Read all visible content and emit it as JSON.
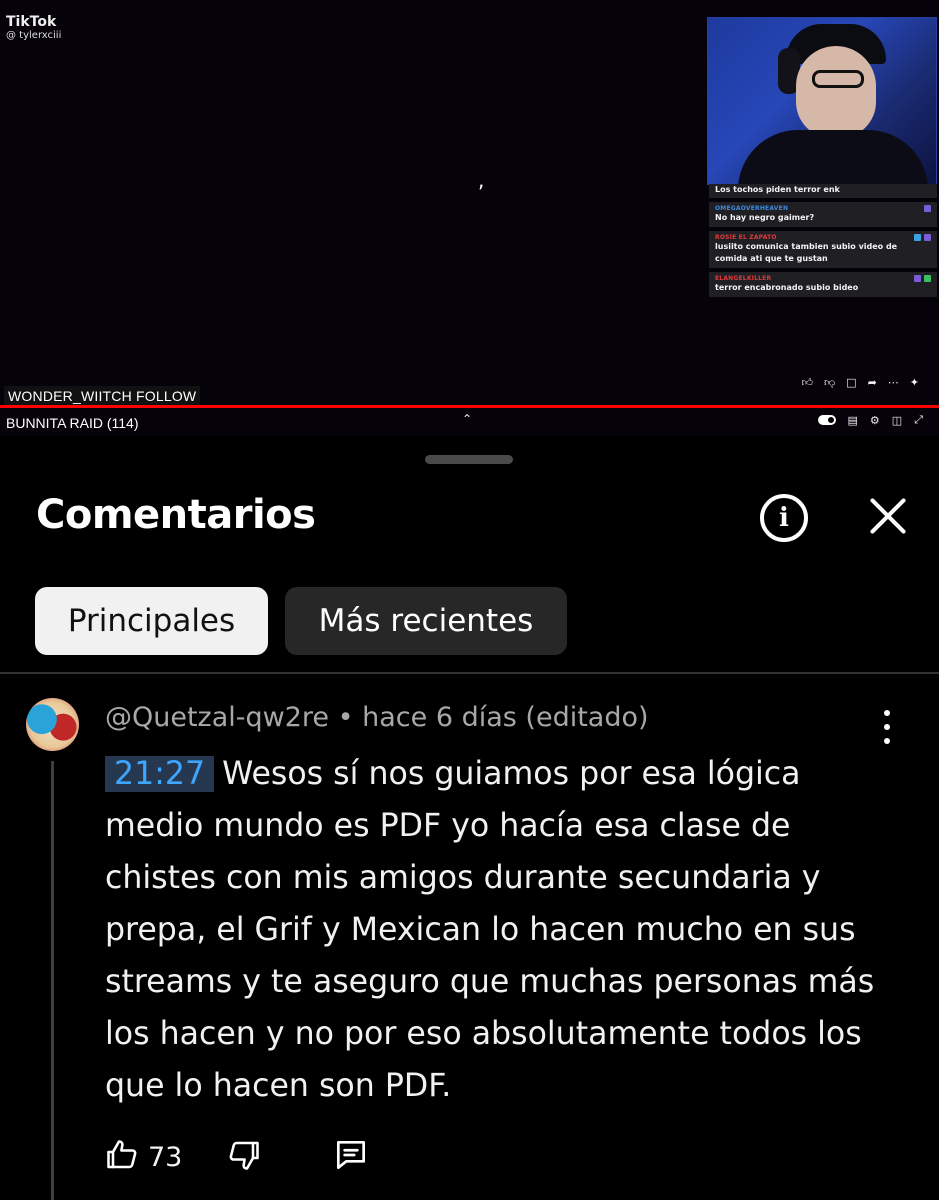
{
  "video": {
    "tiktok_label": "TikTok",
    "tiktok_user": "@ tylerxciii",
    "overlay_char": ",",
    "follow_label": "WONDER_WIITCH  FOLLOW",
    "raid_label": "BUNNITA  RAID (114)",
    "progress_fraction": 1.0,
    "chat": [
      {
        "user": "",
        "text": "Los tochos piden terror enk",
        "user_color": "#999"
      },
      {
        "user": "OMEGAOVERHEAVEN",
        "text": "No hay negro gaimer?",
        "user_color": "#3d8be0"
      },
      {
        "user": "ROSIE EL ZAPATO",
        "text": "lusiito comunica tambien subio video de comida ati que te gustan",
        "user_color": "#e03a3a"
      },
      {
        "user": "ELANGELKILLER",
        "text": "terror encabronado subio bideo",
        "user_color": "#e03a3a"
      }
    ]
  },
  "panel": {
    "title": "Comentarios",
    "filters": {
      "top_label": "Principales",
      "newest_label": "Más recientes",
      "selected": "Principales"
    }
  },
  "comment": {
    "author": "@Quetzal-qw2re",
    "separator": " • ",
    "time": "hace 6 días (editado)",
    "timestamp_link": "21:27",
    "text": "Wesos sí nos guiamos por esa lógica\nmedio mundo es PDF yo hacía esa clase de\nchistes con mis amigos durante secundaria y\nprepa, el Grif y Mexican lo hacen mucho en sus\nstreams y te aseguro que muchas personas más\nlos hacen y no por eso absolutamente todos los\nque lo hacen son PDF.",
    "likes": "73"
  },
  "colors": {
    "background": "#000000",
    "chip_selected_bg": "#f1f1f1",
    "chip_bg": "#272727",
    "timestamp_link": "#3ea6ff",
    "meta_text": "#a8a8a8",
    "progress": "#ff0000"
  },
  "icons": [
    "info-icon",
    "close-icon",
    "more-vert-icon",
    "thumb-up-icon",
    "thumb-down-icon",
    "reply-icon"
  ]
}
